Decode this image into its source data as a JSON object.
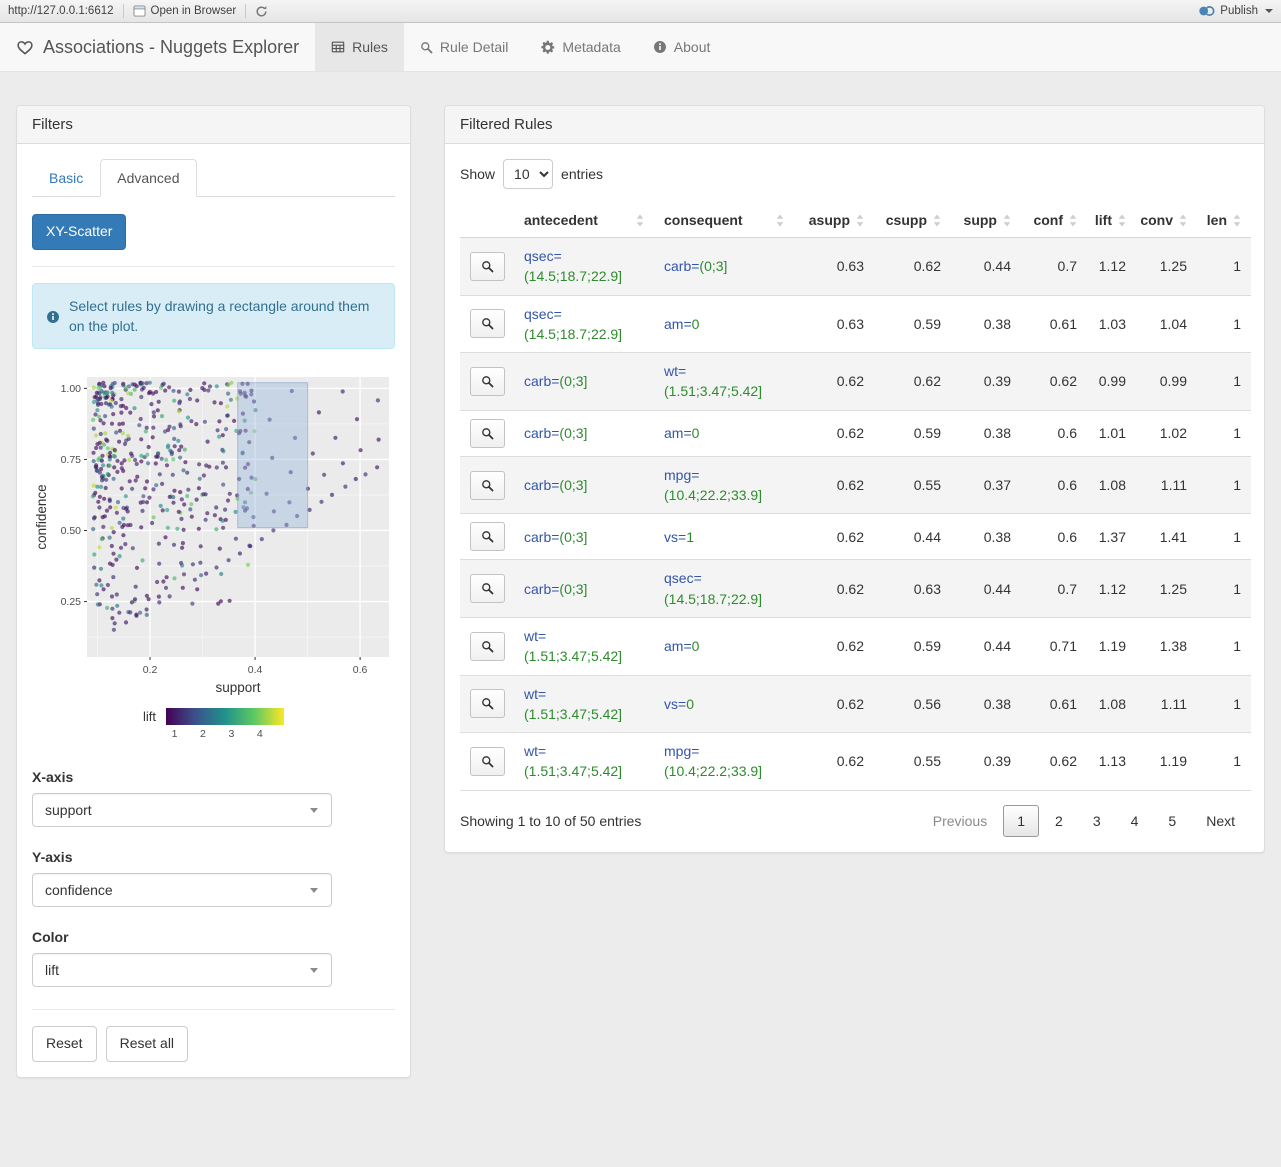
{
  "colors": {
    "accent": "#337ab7",
    "attr_text": "#3355aa",
    "value_text": "#2e8b2e"
  },
  "viewer_bar": {
    "url": "http://127.0.0.1:6612",
    "open_in_browser_label": "Open in Browser",
    "publish_label": "Publish"
  },
  "navbar": {
    "brand": "Associations - Nuggets Explorer",
    "tabs": [
      {
        "label": "Rules",
        "icon": "table-icon",
        "active": true
      },
      {
        "label": "Rule Detail",
        "icon": "search-icon",
        "active": false
      },
      {
        "label": "Metadata",
        "icon": "gear-icon",
        "active": false
      },
      {
        "label": "About",
        "icon": "info-icon",
        "active": false
      }
    ]
  },
  "filters": {
    "title": "Filters",
    "tabs": [
      {
        "label": "Basic",
        "active": false
      },
      {
        "label": "Advanced",
        "active": true
      }
    ],
    "scatter_button_label": "XY-Scatter",
    "info_text": "Select rules by drawing a rectangle around them on the plot.",
    "x_axis": {
      "label": "X-axis",
      "value": "support"
    },
    "y_axis": {
      "label": "Y-axis",
      "value": "confidence"
    },
    "color": {
      "label": "Color",
      "value": "lift"
    },
    "reset_label": "Reset",
    "reset_all_label": "Reset all"
  },
  "chart_data": {
    "type": "scatter",
    "xlabel": "support",
    "ylabel": "confidence",
    "x_ticks": [
      0.2,
      0.4,
      0.6
    ],
    "y_ticks": [
      0.25,
      0.5,
      0.75,
      1.0
    ],
    "xlim": [
      0.08,
      0.655
    ],
    "ylim": [
      0.055,
      1.04
    ],
    "grid": true,
    "color_legend": {
      "label": "lift",
      "ticks": [
        1,
        2,
        3,
        4
      ],
      "range": [
        0.7,
        4.85
      ],
      "palette": "viridis"
    },
    "selection_rect": {
      "x1": 0.367,
      "x2": 0.5,
      "y1": 0.51,
      "y2": 1.02
    },
    "seed": 42,
    "cloud_points": 430,
    "rays": [
      [
        1.14,
        24
      ],
      [
        1.3,
        16
      ],
      [
        1.5,
        13
      ],
      [
        1.75,
        11
      ],
      [
        2.1,
        9
      ],
      [
        2.6,
        8
      ],
      [
        3.2,
        7
      ]
    ],
    "points_note": "~520 rules: dense cluster at support 0.09-0.35 spanning confidence 0.2-1.0 (densest near 1.0), ascending collinear rays reaching support 0.63 / confidence 0.73; colors mostly lift 1-2 (purple/blue) with scattered teal-green up to lift 4"
  },
  "rules_panel": {
    "title": "Filtered Rules",
    "show_label": "Show",
    "entries_label": "entries",
    "page_length": "10",
    "columns": [
      {
        "key": "detail",
        "label": "",
        "numeric": false
      },
      {
        "key": "antecedent",
        "label": "antecedent",
        "numeric": false
      },
      {
        "key": "consequent",
        "label": "consequent",
        "numeric": false
      },
      {
        "key": "asupp",
        "label": "asupp",
        "numeric": true
      },
      {
        "key": "csupp",
        "label": "csupp",
        "numeric": true
      },
      {
        "key": "supp",
        "label": "supp",
        "numeric": true
      },
      {
        "key": "conf",
        "label": "conf",
        "numeric": true
      },
      {
        "key": "lift",
        "label": "lift",
        "numeric": true
      },
      {
        "key": "conv",
        "label": "conv",
        "numeric": true
      },
      {
        "key": "len",
        "label": "len",
        "numeric": true
      }
    ],
    "rows": [
      {
        "a_attr": "qsec=",
        "a_val": "(14.5;18.7;22.9]",
        "c_attr": "carb=",
        "c_val": "(0;3]",
        "asupp": "0.63",
        "csupp": "0.62",
        "supp": "0.44",
        "conf": "0.7",
        "lift": "1.12",
        "conv": "1.25",
        "len": "1"
      },
      {
        "a_attr": "qsec=",
        "a_val": "(14.5;18.7;22.9]",
        "c_attr": "am=",
        "c_val": "0",
        "asupp": "0.63",
        "csupp": "0.59",
        "supp": "0.38",
        "conf": "0.61",
        "lift": "1.03",
        "conv": "1.04",
        "len": "1"
      },
      {
        "a_attr": "carb=",
        "a_val": "(0;3]",
        "c_attr": "wt=",
        "c_val": "(1.51;3.47;5.42]",
        "asupp": "0.62",
        "csupp": "0.62",
        "supp": "0.39",
        "conf": "0.62",
        "lift": "0.99",
        "conv": "0.99",
        "len": "1"
      },
      {
        "a_attr": "carb=",
        "a_val": "(0;3]",
        "c_attr": "am=",
        "c_val": "0",
        "asupp": "0.62",
        "csupp": "0.59",
        "supp": "0.38",
        "conf": "0.6",
        "lift": "1.01",
        "conv": "1.02",
        "len": "1"
      },
      {
        "a_attr": "carb=",
        "a_val": "(0;3]",
        "c_attr": "mpg=",
        "c_val": "(10.4;22.2;33.9]",
        "asupp": "0.62",
        "csupp": "0.55",
        "supp": "0.37",
        "conf": "0.6",
        "lift": "1.08",
        "conv": "1.11",
        "len": "1"
      },
      {
        "a_attr": "carb=",
        "a_val": "(0;3]",
        "c_attr": "vs=",
        "c_val": "1",
        "asupp": "0.62",
        "csupp": "0.44",
        "supp": "0.38",
        "conf": "0.6",
        "lift": "1.37",
        "conv": "1.41",
        "len": "1"
      },
      {
        "a_attr": "carb=",
        "a_val": "(0;3]",
        "c_attr": "qsec=",
        "c_val": "(14.5;18.7;22.9]",
        "asupp": "0.62",
        "csupp": "0.63",
        "supp": "0.44",
        "conf": "0.7",
        "lift": "1.12",
        "conv": "1.25",
        "len": "1"
      },
      {
        "a_attr": "wt=",
        "a_val": "(1.51;3.47;5.42]",
        "c_attr": "am=",
        "c_val": "0",
        "asupp": "0.62",
        "csupp": "0.59",
        "supp": "0.44",
        "conf": "0.71",
        "lift": "1.19",
        "conv": "1.38",
        "len": "1"
      },
      {
        "a_attr": "wt=",
        "a_val": "(1.51;3.47;5.42]",
        "c_attr": "vs=",
        "c_val": "0",
        "asupp": "0.62",
        "csupp": "0.56",
        "supp": "0.38",
        "conf": "0.61",
        "lift": "1.08",
        "conv": "1.11",
        "len": "1"
      },
      {
        "a_attr": "wt=",
        "a_val": "(1.51;3.47;5.42]",
        "c_attr": "mpg=",
        "c_val": "(10.4;22.2;33.9]",
        "asupp": "0.62",
        "csupp": "0.55",
        "supp": "0.39",
        "conf": "0.62",
        "lift": "1.13",
        "conv": "1.19",
        "len": "1"
      }
    ],
    "info_text": "Showing 1 to 10 of 50 entries",
    "pagination": {
      "previous_label": "Previous",
      "pages": [
        "1",
        "2",
        "3",
        "4",
        "5"
      ],
      "active_page": "1",
      "next_label": "Next"
    }
  }
}
